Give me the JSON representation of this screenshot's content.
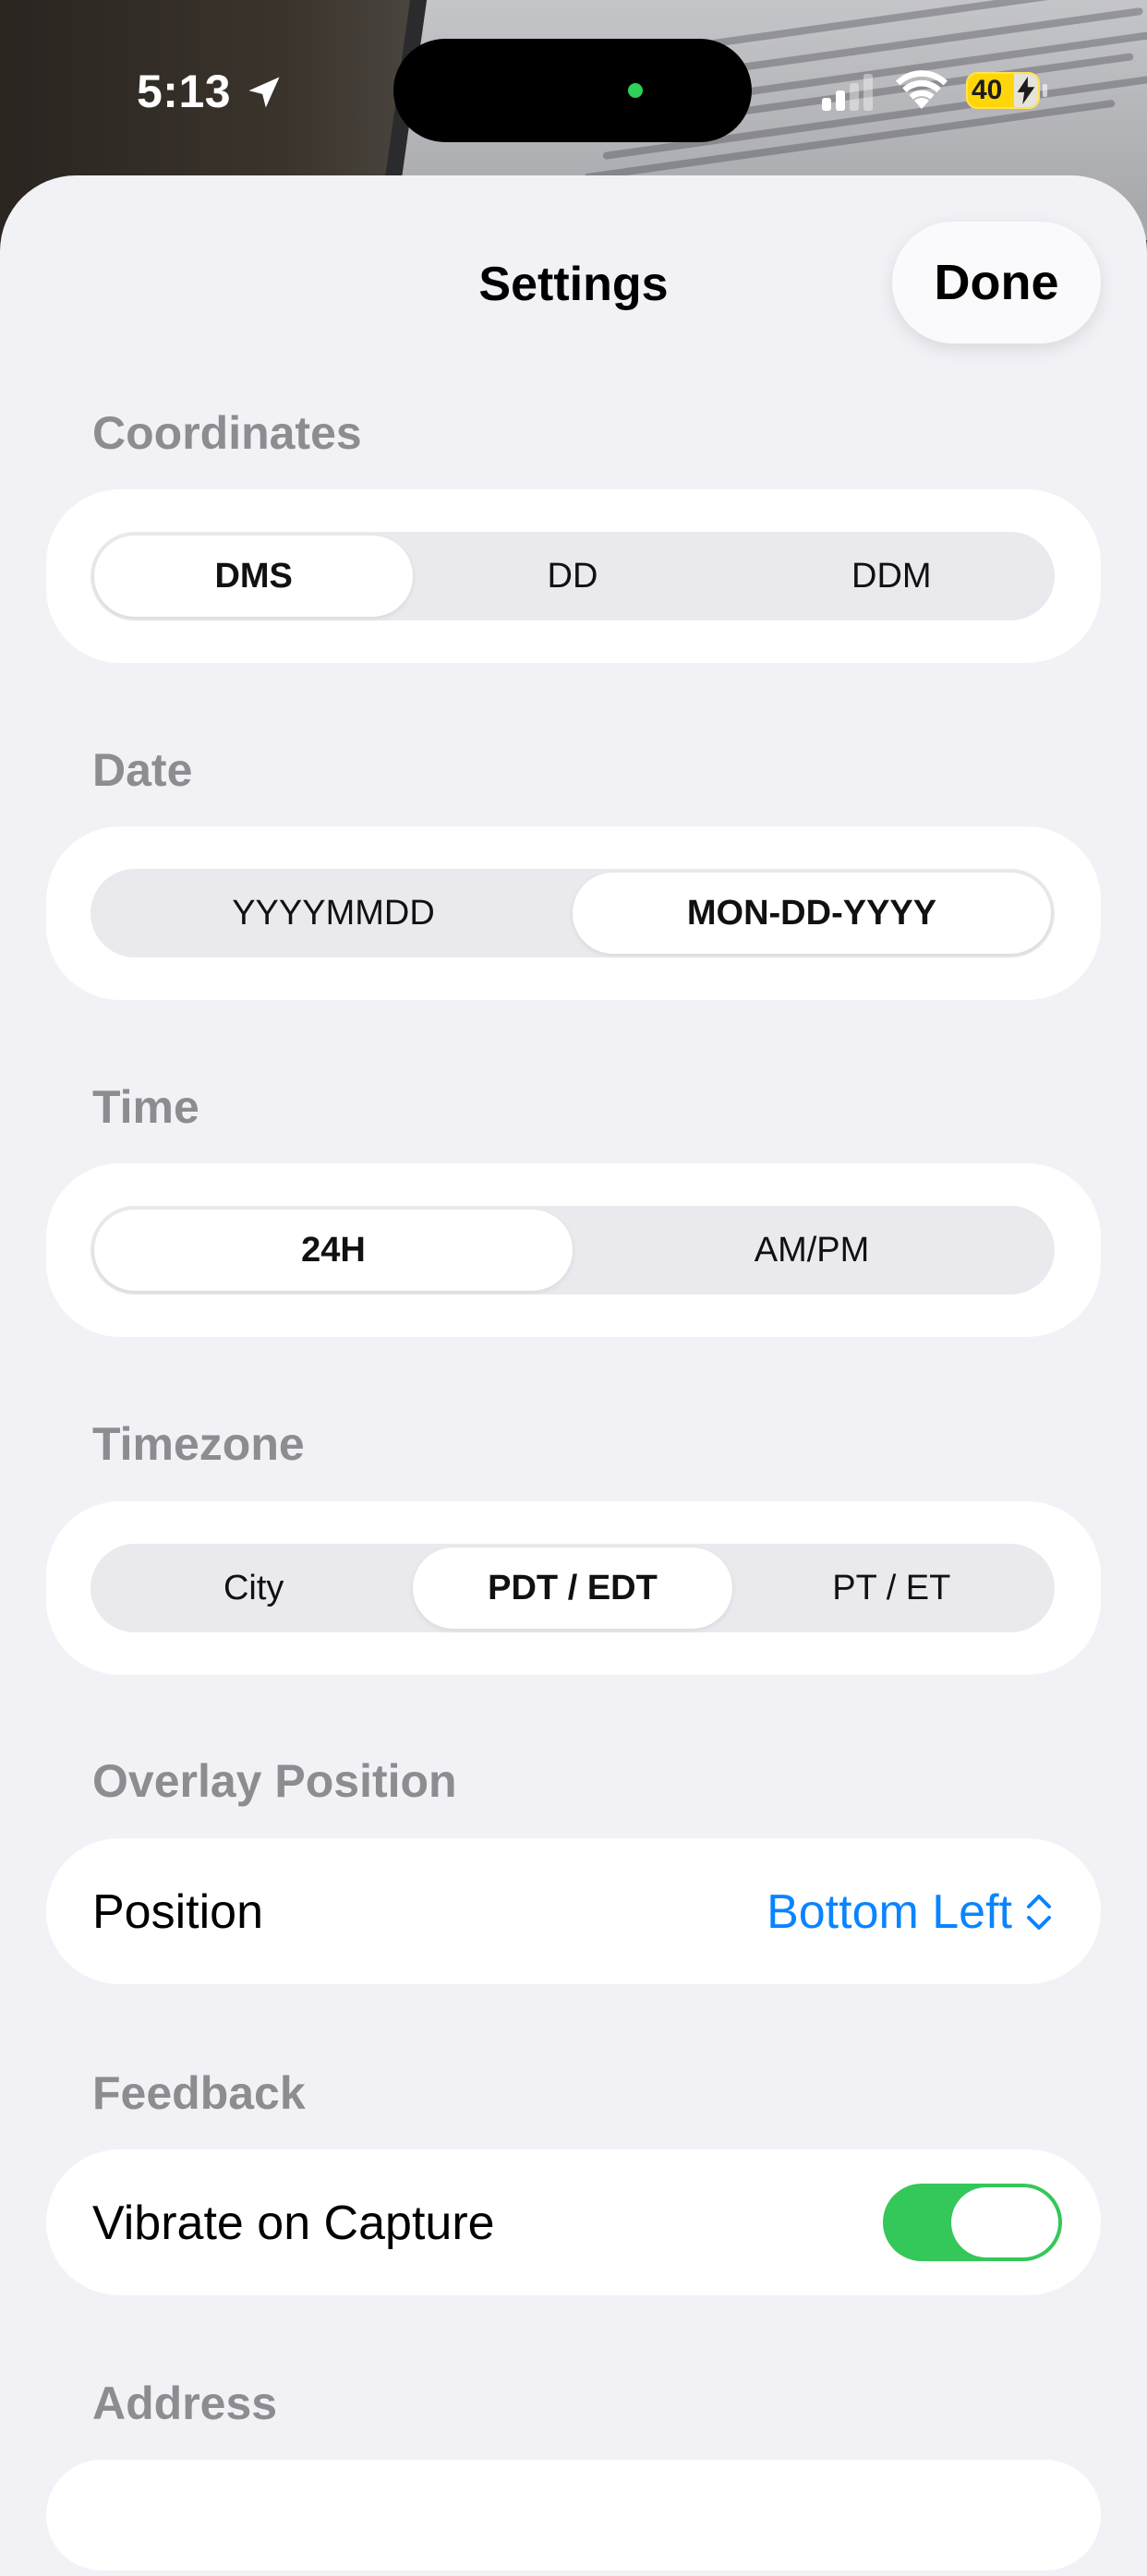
{
  "status_bar": {
    "time": "5:13",
    "battery_percent": "40",
    "icons": [
      "location-arrow-icon",
      "cellular-signal-icon",
      "wifi-icon",
      "battery-charging-icon"
    ]
  },
  "nav": {
    "title": "Settings",
    "done_label": "Done"
  },
  "sections": {
    "coordinates": {
      "header": "Coordinates",
      "options": [
        "DMS",
        "DD",
        "DDM"
      ],
      "selected": "DMS"
    },
    "date": {
      "header": "Date",
      "options": [
        "YYYYMMDD",
        "MON-DD-YYYY"
      ],
      "selected": "MON-DD-YYYY"
    },
    "time": {
      "header": "Time",
      "options": [
        "24H",
        "AM/PM"
      ],
      "selected": "24H"
    },
    "timezone": {
      "header": "Timezone",
      "options": [
        "City",
        "PDT / EDT",
        "PT / ET"
      ],
      "selected": "PDT / EDT"
    },
    "overlay": {
      "header": "Overlay Position",
      "row_label": "Position",
      "value": "Bottom Left"
    },
    "feedback": {
      "header": "Feedback",
      "row_label": "Vibrate on Capture",
      "toggle_on": true
    },
    "address": {
      "header": "Address"
    }
  },
  "colors": {
    "accent": "#0a84ff",
    "toggle_on": "#34c759",
    "background": "#f1f1f6",
    "section_header": "#8c8c91"
  }
}
